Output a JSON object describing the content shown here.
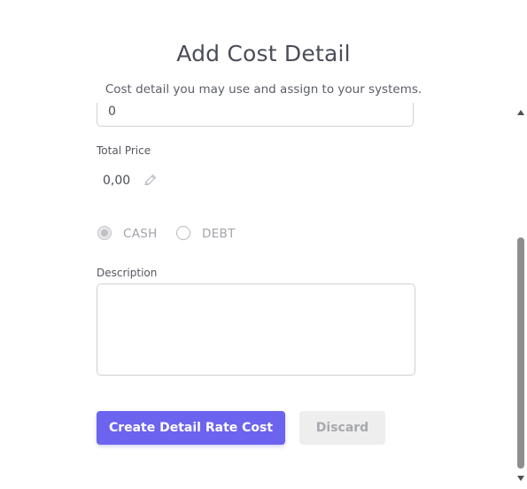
{
  "modal": {
    "title": "Add Cost Detail",
    "subtitle": "Cost detail you may use and assign to your systems."
  },
  "form": {
    "quantity_value": "0",
    "total_price_label": "Total Price",
    "total_price_value": "0,00",
    "payment_type": {
      "options": [
        "CASH",
        "DEBT"
      ],
      "selected": "CASH"
    },
    "description_label": "Description",
    "description_value": ""
  },
  "actions": {
    "create_label": "Create Detail Rate Cost",
    "discard_label": "Discard"
  },
  "icons": {
    "edit": "pencil-edit-icon"
  },
  "colors": {
    "primary": "#6c63ee",
    "secondary_bg": "#eeeeef"
  }
}
